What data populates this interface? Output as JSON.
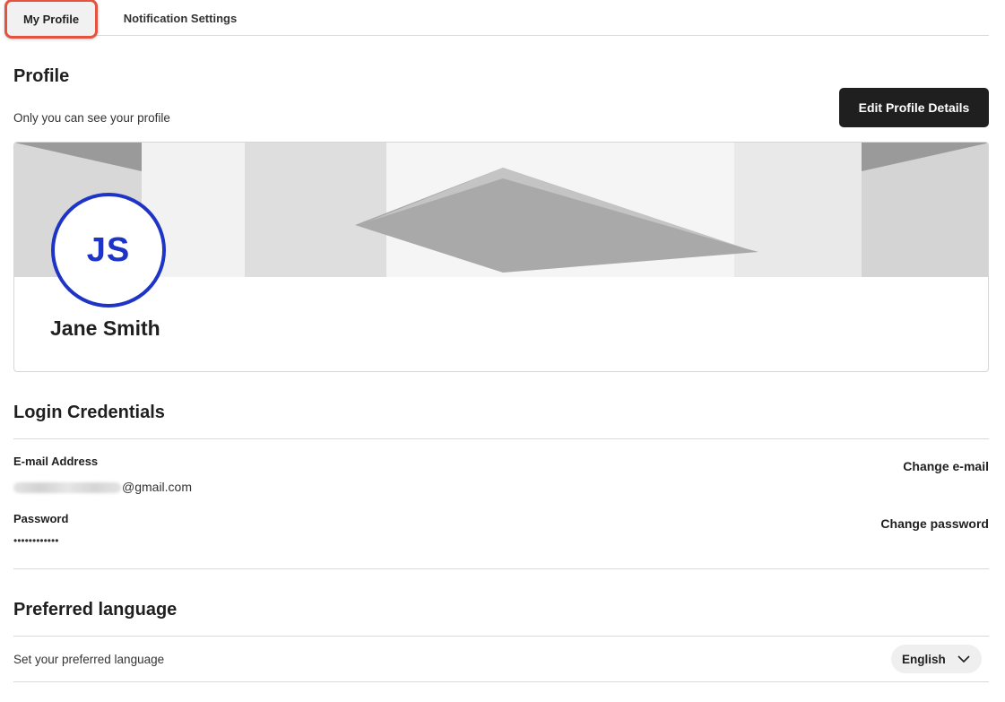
{
  "tabs": [
    {
      "label": "My Profile",
      "active": true
    },
    {
      "label": "Notification Settings",
      "active": false
    }
  ],
  "profile": {
    "title": "Profile",
    "subtitle": "Only you can see your profile",
    "edit_button": "Edit Profile Details",
    "initials": "JS",
    "name": "Jane Smith",
    "avatar_color": "#1d34c7"
  },
  "login": {
    "title": "Login Credentials",
    "email_label": "E-mail Address",
    "email_domain": "@gmail.com",
    "change_email": "Change e-mail",
    "password_label": "Password",
    "password_value": "••••••••••••",
    "change_password": "Change password"
  },
  "language": {
    "title": "Preferred language",
    "subtitle": "Set your preferred language",
    "selected": "English"
  },
  "colors": {
    "highlight": "#e5533f",
    "button_bg": "#1f1f1f"
  }
}
